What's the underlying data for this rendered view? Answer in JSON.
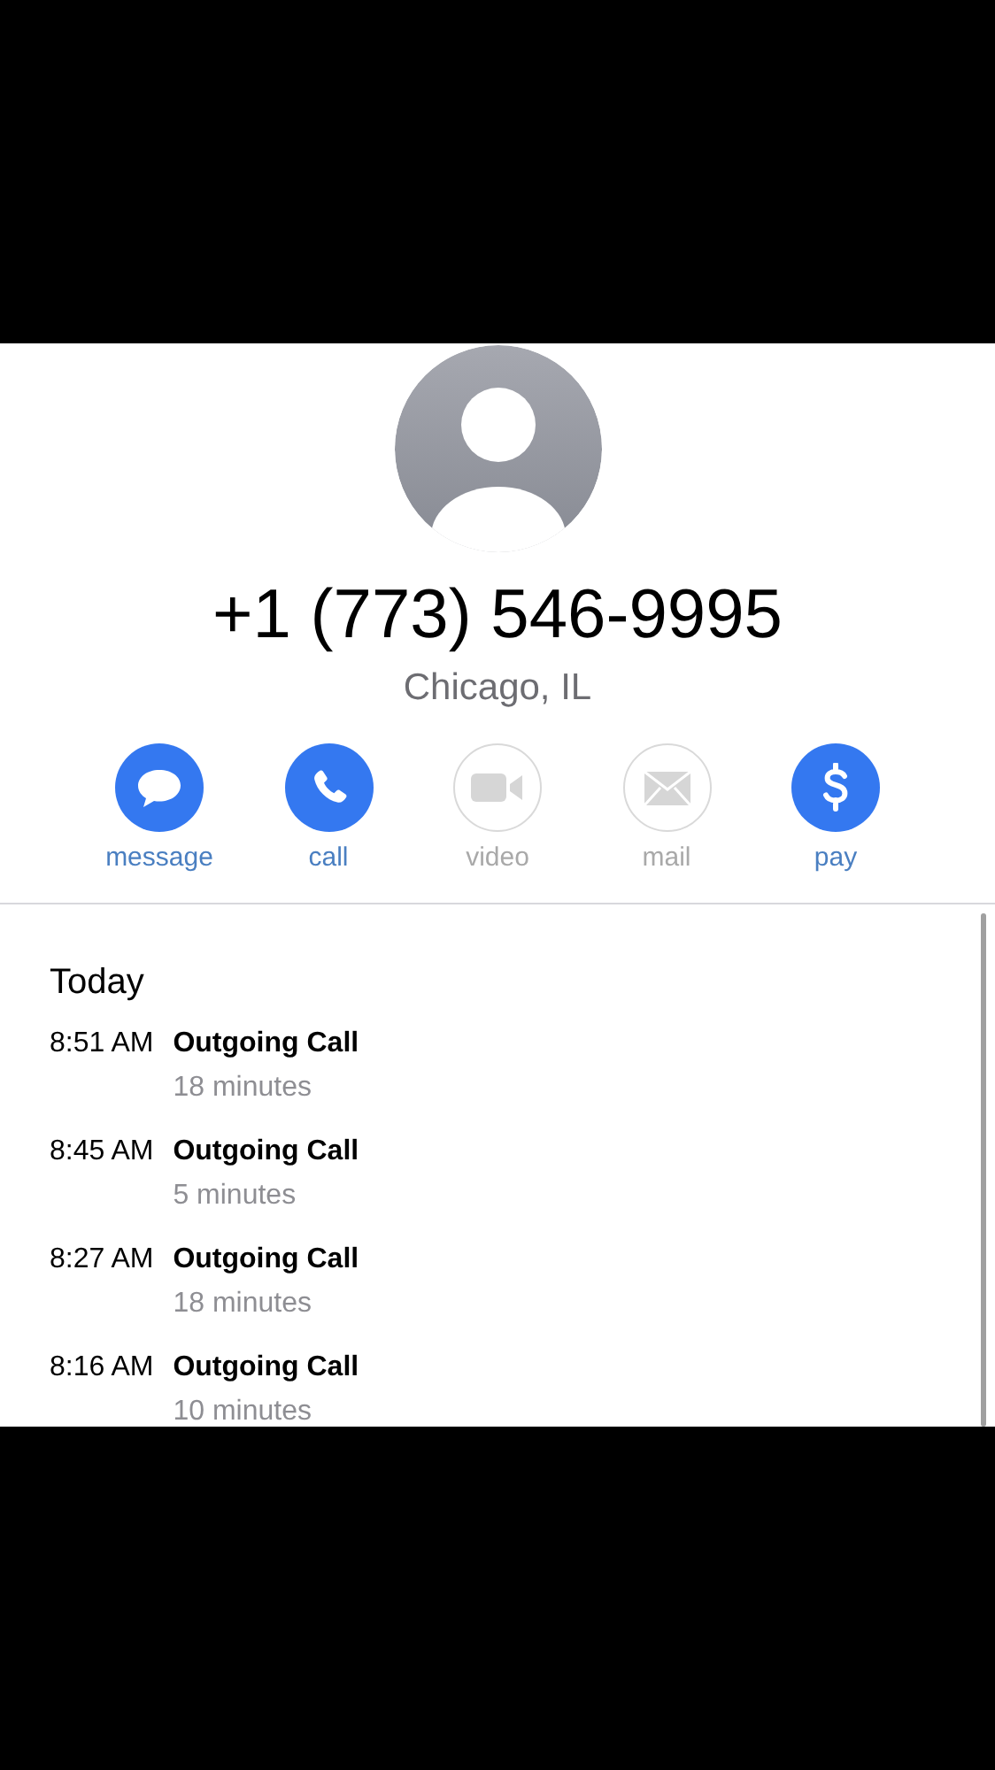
{
  "contact": {
    "phone": "+1 (773) 546-9995",
    "location": "Chicago, IL"
  },
  "actions": [
    {
      "kind": "message",
      "label": "message",
      "disabled": false
    },
    {
      "kind": "call",
      "label": "call",
      "disabled": false
    },
    {
      "kind": "video",
      "label": "video",
      "disabled": true
    },
    {
      "kind": "mail",
      "label": "mail",
      "disabled": true
    },
    {
      "kind": "pay",
      "label": "pay",
      "disabled": false
    }
  ],
  "history": {
    "heading": "Today",
    "calls": [
      {
        "time": "8:51 AM",
        "type": "Outgoing Call",
        "duration": "18 minutes"
      },
      {
        "time": "8:45 AM",
        "type": "Outgoing Call",
        "duration": "5 minutes"
      },
      {
        "time": "8:27 AM",
        "type": "Outgoing Call",
        "duration": "18 minutes"
      },
      {
        "time": "8:16 AM",
        "type": "Outgoing Call",
        "duration": "10 minutes"
      }
    ]
  }
}
